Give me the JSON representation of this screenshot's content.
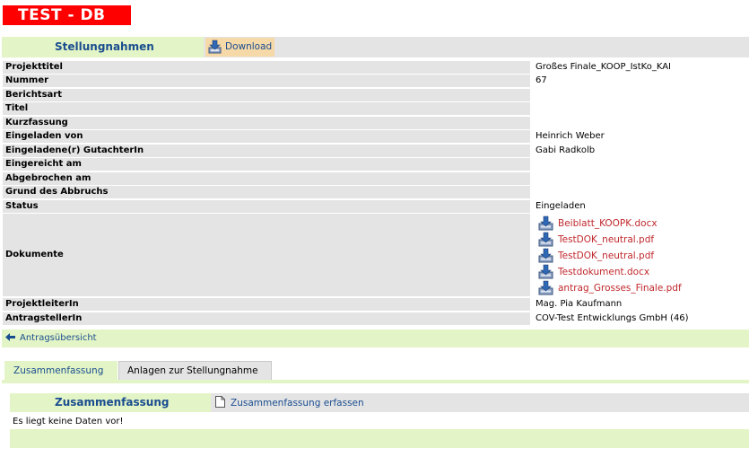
{
  "app": {
    "logo_text": "TEST - DB"
  },
  "header": {
    "section_title": "Stellungnahmen",
    "download_label": "Download"
  },
  "details": {
    "rows": [
      {
        "label": "Projekttitel",
        "value": "Großes Finale_KOOP_IstKo_KAI"
      },
      {
        "label": "Nummer",
        "value": "67"
      },
      {
        "label": "Berichtsart",
        "value": ""
      },
      {
        "label": "Titel",
        "value": ""
      },
      {
        "label": "Kurzfassung",
        "value": ""
      },
      {
        "label": "Eingeladen von",
        "value": "Heinrich Weber"
      },
      {
        "label": "Eingeladene(r) GutachterIn",
        "value": "Gabi Radkolb"
      },
      {
        "label": "Eingereicht am",
        "value": ""
      },
      {
        "label": "Abgebrochen am",
        "value": ""
      },
      {
        "label": "Grund des Abbruchs",
        "value": ""
      },
      {
        "label": "Status",
        "value": "Eingeladen"
      }
    ],
    "documents_label": "Dokumente",
    "documents": [
      "Beiblatt_KOOPK.docx",
      "TestDOK_neutral.pdf",
      "TestDOK_neutral.pdf",
      "Testdokument.docx",
      "antrag_Grosses_Finale.pdf"
    ],
    "rows_after": [
      {
        "label": "ProjektleiterIn",
        "value": "Mag. Pia Kaufmann"
      },
      {
        "label": "AntragstellerIn",
        "value": "COV-Test Entwicklungs GmbH (46)"
      }
    ]
  },
  "nav": {
    "back_label": "Antragsübersicht"
  },
  "tabs": [
    {
      "label": "Zusammenfassung",
      "active": true
    },
    {
      "label": "Anlagen zur Stellungnahme",
      "active": false
    }
  ],
  "panel": {
    "title": "Zusammenfassung",
    "capture_label": "Zusammenfassung erfassen",
    "empty_message": "Es liegt keine Daten vor!"
  },
  "colors": {
    "logo_red": "#ff0000",
    "light_green": "#e3f5c6",
    "gray": "#e4e4e4",
    "link_blue": "#1a4d8f",
    "doc_red": "#c0282d",
    "download_orange": "#f6d9a8"
  },
  "icons": {
    "download": "download-tray-icon",
    "document": "document-download-icon",
    "back": "arrow-left-icon",
    "capture": "page-icon"
  }
}
